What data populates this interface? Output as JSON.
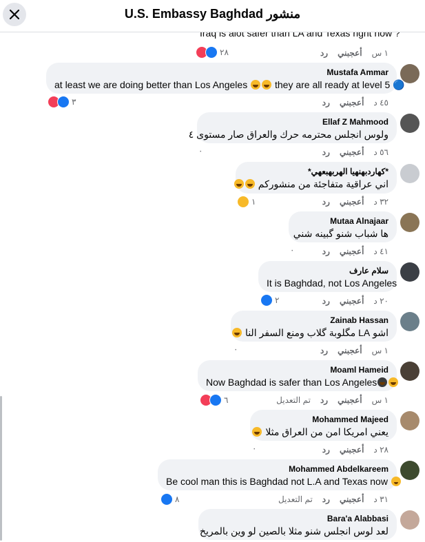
{
  "header": {
    "title": "U.S. Embassy Baghdad منشور"
  },
  "top_comment": {
    "text_fragment": "Iraq is alot safer than LA and Texas right now ?",
    "time": "١ س",
    "like_label": "أعجبني",
    "reply_label": "رد",
    "reaction_count": "٢٨"
  },
  "comments": [
    {
      "author": "Mustafa Ammar",
      "text": "at least we are doing better than Los Angeles",
      "text2": "they are all ready at level 5 🔵",
      "time": "٤٥ د",
      "like_label": "أعجبني",
      "reply_label": "رد",
      "reaction_count": "٣"
    },
    {
      "author": "Ellaf Z Mahmood",
      "text": "ولوس انجلس محترمه حرك والعراق صار مستوى ٤",
      "time": "٥٦ د",
      "like_label": "أعجبني",
      "reply_label": "رد",
      "reaction_count": "٠"
    },
    {
      "author": "*كهاردبهنهيا الهربهبعهي*",
      "text": "اني عراقية متفاجئة من منشوركم",
      "time": "٣٢ د",
      "like_label": "أعجبني",
      "reply_label": "رد",
      "reaction_count": "١"
    },
    {
      "author": "Mutaa Alnajaar",
      "text": "ها شباب شنو گبينه شني",
      "time": "٤١ د",
      "like_label": "أعجبني",
      "reply_label": "رد",
      "reaction_count": "٠"
    },
    {
      "author": "سلام عارف",
      "text": "It is Baghdad, not Los Angeles",
      "time": "٢٠ د",
      "like_label": "أعجبني",
      "reply_label": "رد",
      "reaction_count": "٢"
    },
    {
      "author": "Zainab Hassan",
      "text": "اشو LA مگلوبة گلاب ومنع السفر النا",
      "time": "١ س",
      "like_label": "أعجبني",
      "reply_label": "رد",
      "reaction_count": "٠"
    },
    {
      "author": "Moaml Hameid",
      "text": "Now Baghdad is safer than Los Angeles",
      "time": "١ س",
      "like_label": "أعجبني",
      "reply_label": "رد",
      "edited_label": "تم التعديل",
      "reaction_count": "٦"
    },
    {
      "author": "Mohammed Majeed",
      "text": "يعني امريكا امن من العراق مثلا",
      "time": "٢٨ د",
      "like_label": "أعجبني",
      "reply_label": "رد",
      "reaction_count": "٠"
    },
    {
      "author": "Mohammed Abdelkareem",
      "text": "Be cool man this is Baghdad not L.A and Texas now",
      "time": "٣١ د",
      "like_label": "أعجبني",
      "reply_label": "رد",
      "edited_label": "تم التعديل",
      "reaction_count": "٨"
    },
    {
      "author": "Bara'a Alabbasi",
      "text": "لعد لوس انجلس شنو مثلا بالصين لو وين بالمريخ"
    }
  ],
  "colors": {
    "like": "#1877f2",
    "love": "#f33e58",
    "haha": "#f7b928",
    "bubble": "#f0f2f5",
    "meta": "#65676b"
  }
}
